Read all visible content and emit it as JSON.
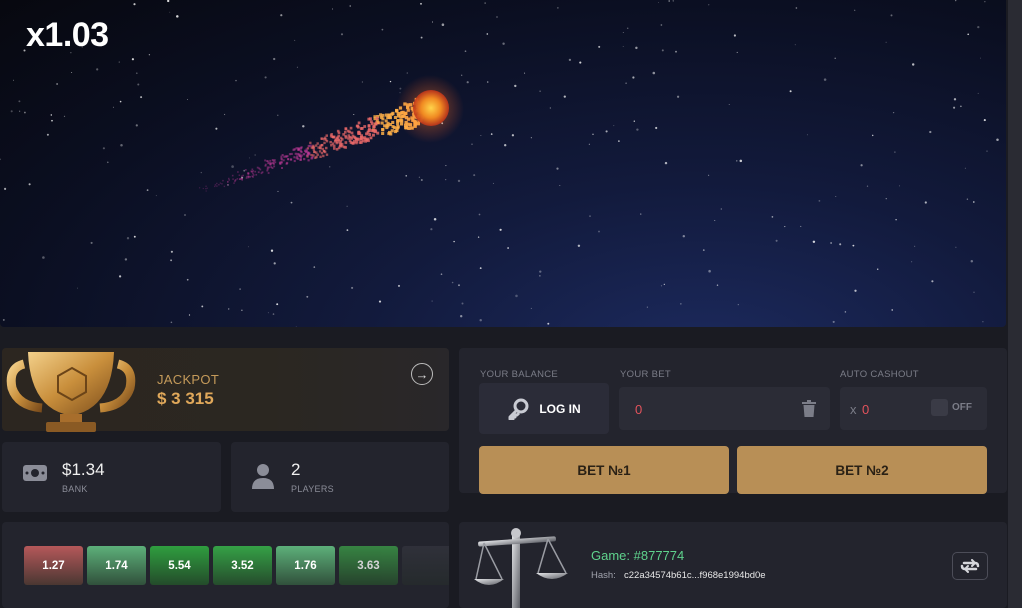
{
  "game": {
    "multiplier": "x1.03"
  },
  "jackpot": {
    "label": "JACKPOT",
    "value": "$ 3 315"
  },
  "stats": {
    "bank": {
      "value": "$1.34",
      "label": "BANK"
    },
    "players": {
      "value": "2",
      "label": "PLAYERS"
    }
  },
  "history": [
    {
      "value": "1.27",
      "color": "#b5585a"
    },
    {
      "value": "1.74",
      "color": "#5db07a"
    },
    {
      "value": "5.54",
      "color": "#2f9e3f"
    },
    {
      "value": "3.52",
      "color": "#35a146"
    },
    {
      "value": "1.76",
      "color": "#5db07a"
    },
    {
      "value": "3.63",
      "color": "#3c9c48"
    },
    {
      "value": "",
      "color": "#3a3b44"
    }
  ],
  "bet": {
    "balance_label": "YOUR BALANCE",
    "login_label": "LOG IN",
    "bet_label": "YOUR BET",
    "bet_value": "0",
    "auto_label": "AUTO CASHOUT",
    "auto_prefix": "x",
    "auto_value": "0",
    "auto_toggle": "OFF",
    "bet1": "BET №1",
    "bet2": "BET №2"
  },
  "round": {
    "title": "Game: #877774",
    "hash_label": "Hash:",
    "hash": "c22a34574b61c...f968e1994bd0e"
  },
  "colors": {
    "accent": "#b88f56",
    "jackpot": "#e0a85a",
    "green": "#5fd38d",
    "red": "#e2535c"
  }
}
